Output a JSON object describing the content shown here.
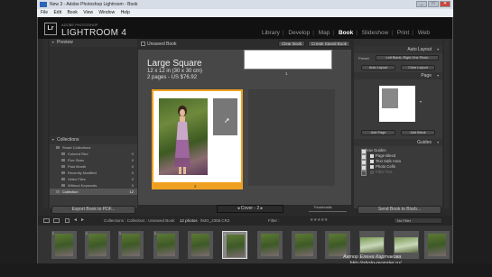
{
  "window": {
    "title": "New 3 - Adobe Photoshop Lightroom - Book",
    "min": "_",
    "max": "□",
    "close": "✕"
  },
  "menu": [
    "File",
    "Edit",
    "Book",
    "View",
    "Window",
    "Help"
  ],
  "identity": {
    "logo": "Lr",
    "small": "ADOBE PHOTOSHOP",
    "big": "LIGHTROOM 4"
  },
  "modules": [
    {
      "label": "Library",
      "active": false
    },
    {
      "label": "Develop",
      "active": false
    },
    {
      "label": "Map",
      "active": false
    },
    {
      "label": "Book",
      "active": true
    },
    {
      "label": "Slideshow",
      "active": false
    },
    {
      "label": "Print",
      "active": false
    },
    {
      "label": "Web",
      "active": false
    }
  ],
  "left_panel": {
    "preview_title": "Preview",
    "collections_title": "Collections",
    "collections": [
      {
        "label": "Smart Collections",
        "count": ""
      },
      {
        "label": "Colored Red",
        "count": "0"
      },
      {
        "label": "Five Stars",
        "count": "0"
      },
      {
        "label": "Past Month",
        "count": "0"
      },
      {
        "label": "Recently Modified",
        "count": "0"
      },
      {
        "label": "Video Files",
        "count": "0"
      },
      {
        "label": "Without Keywords",
        "count": "0"
      },
      {
        "label": "Collection",
        "count": "12"
      }
    ],
    "export_label": "Export Book to PDF..."
  },
  "center": {
    "book_name": "Unsaved Book",
    "clear_label": "Clear Book",
    "create_label": "Create Saved Book",
    "size_title": "Large Square",
    "dims": "12 x 12 in (30 x 30 cm)",
    "pages_price": "2 pages - US $76.92",
    "page1_number": "1",
    "page2_number": "2",
    "page_nav": "Cover - 2",
    "thumbnails_label": "Thumbnails"
  },
  "right_panel": {
    "auto_layout_title": "Auto Layout",
    "preset_label": "Preset:",
    "preset_value": "Left Blank, Right One Photo",
    "auto_layout_btn": "Auto Layout",
    "clear_layout_btn": "Clear Layout",
    "page_title": "Page",
    "add_page_btn": "Add Page",
    "add_blank_btn": "Add Blank",
    "guides_title": "Guides",
    "show_guides": "Show Guides",
    "guides": [
      {
        "label": "Page Bleed",
        "checked": true
      },
      {
        "label": "Text Safe Area",
        "checked": true
      },
      {
        "label": "Photo Cells",
        "checked": true
      },
      {
        "label": "Filler Text",
        "checked": false
      }
    ],
    "send_label": "Send Book to Blurb..."
  },
  "filmstrip": {
    "crumb": "Collections : Collection : Unsaved Book",
    "count": "12 photos",
    "selected": "/IMG_2358.CR2",
    "filter_label": "Filter :",
    "stars": "★★★★★",
    "no_filter": "No Filter",
    "thumbs": [
      {
        "badge": "1",
        "wide": false
      },
      {
        "badge": "1",
        "wide": false
      },
      {
        "badge": "1",
        "wide": false
      },
      {
        "badge": "1",
        "wide": false
      },
      {
        "badge": "",
        "wide": false
      },
      {
        "badge": "1",
        "wide": false,
        "selected": true
      },
      {
        "badge": "",
        "wide": false
      },
      {
        "badge": "",
        "wide": false
      },
      {
        "badge": "",
        "wide": false
      },
      {
        "badge": "",
        "wide": true
      },
      {
        "badge": "",
        "wide": true
      },
      {
        "badge": "",
        "wide": false
      }
    ]
  },
  "watermark": {
    "line1": "Автор Елена Картакова",
    "line2": "http://photo-monster.ru/"
  }
}
